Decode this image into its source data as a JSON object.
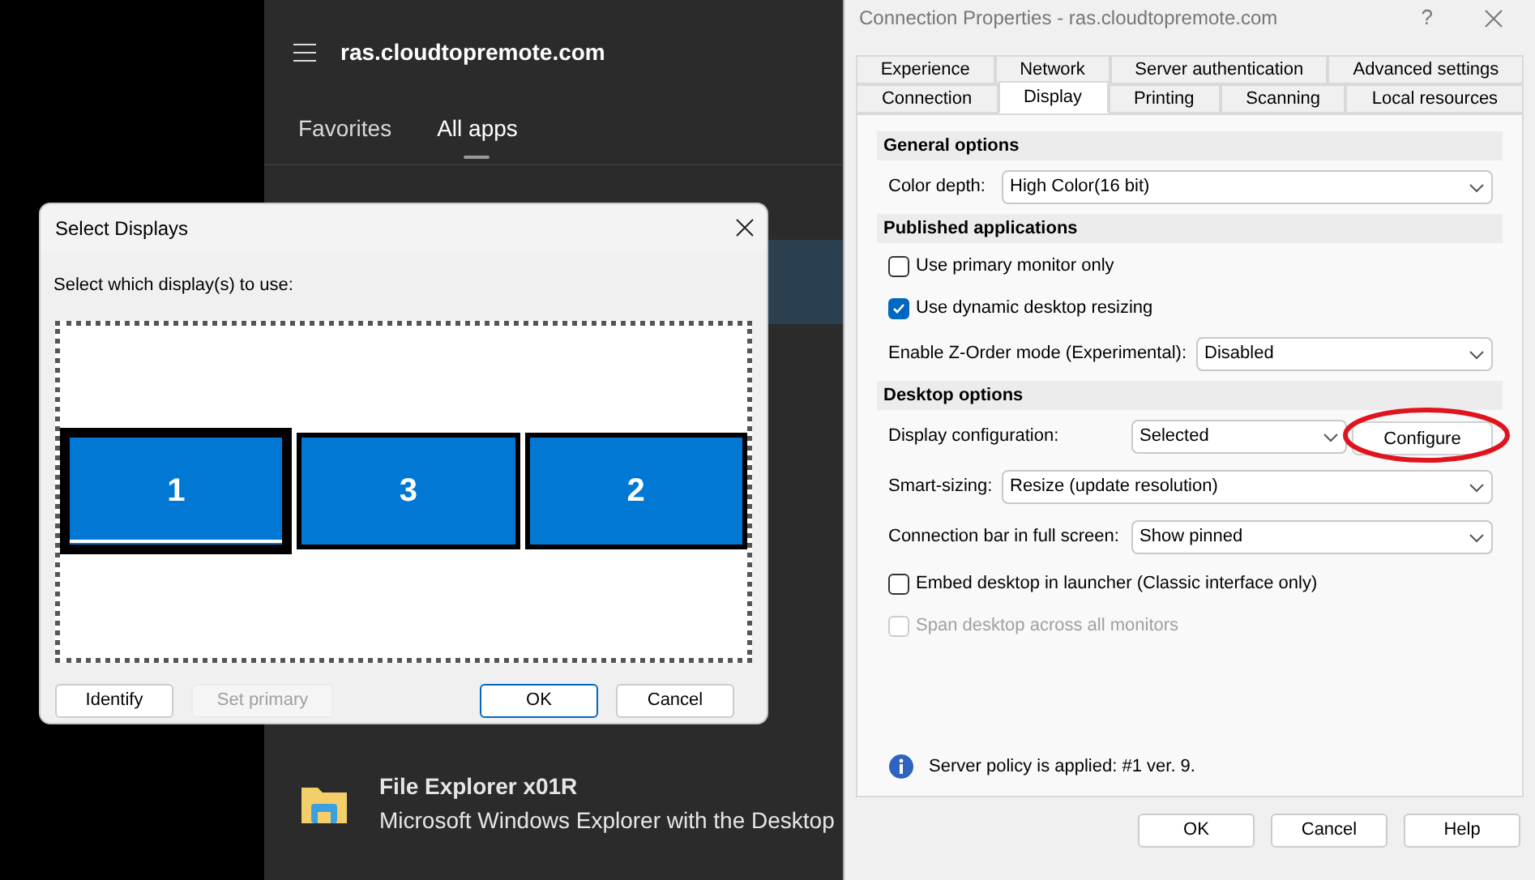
{
  "launcher": {
    "title": "ras.cloudtopremote.com",
    "tabs": [
      {
        "label": "Favorites",
        "selected": false
      },
      {
        "label": "All apps",
        "selected": true
      }
    ],
    "apps": [
      {
        "name": "File Explorer x01R",
        "description": "Microsoft Windows Explorer with the Desktop"
      }
    ]
  },
  "select_displays": {
    "title": "Select Displays",
    "prompt": "Select which display(s) to use:",
    "displays": [
      {
        "label": "1",
        "selected": true,
        "primary": true
      },
      {
        "label": "3",
        "selected": true,
        "primary": false
      },
      {
        "label": "2",
        "selected": true,
        "primary": false
      }
    ],
    "buttons": [
      {
        "label": "Identify",
        "disabled": false,
        "default": false
      },
      {
        "label": "Set primary",
        "disabled": true,
        "default": false
      },
      {
        "label": "OK",
        "disabled": false,
        "default": true
      },
      {
        "label": "Cancel",
        "disabled": false,
        "default": false
      }
    ]
  },
  "connection_properties": {
    "title": "Connection Properties - ras.cloudtopremote.com",
    "help": "?",
    "tab_rows": [
      [
        {
          "label": "Experience",
          "selected": false
        },
        {
          "label": "Network",
          "selected": false
        },
        {
          "label": "Server authentication",
          "selected": false
        },
        {
          "label": "Advanced settings",
          "selected": false
        }
      ],
      [
        {
          "label": "Connection",
          "selected": false
        },
        {
          "label": "Display",
          "selected": true
        },
        {
          "label": "Printing",
          "selected": false
        },
        {
          "label": "Scanning",
          "selected": false
        },
        {
          "label": "Local resources",
          "selected": false
        }
      ]
    ],
    "sections": [
      {
        "heading": "General options",
        "rows": [
          {
            "kind": "select",
            "label": "Color depth:",
            "value": "High Color(16 bit)"
          }
        ]
      },
      {
        "heading": "Published applications",
        "rows": [
          {
            "kind": "checkbox",
            "label": "Use primary monitor only",
            "checked": false,
            "disabled": false
          },
          {
            "kind": "checkbox",
            "label": "Use dynamic desktop resizing",
            "checked": true,
            "disabled": false
          },
          {
            "kind": "select",
            "label": "Enable Z-Order mode (Experimental):",
            "value": "Disabled"
          }
        ]
      },
      {
        "heading": "Desktop options",
        "rows": [
          {
            "kind": "select_button",
            "label": "Display configuration:",
            "value": "Selected",
            "button": "Configure",
            "highlighted": true
          },
          {
            "kind": "select",
            "label": "Smart-sizing:",
            "value": "Resize (update resolution)"
          },
          {
            "kind": "select",
            "label": "Connection bar in full screen:",
            "value": "Show pinned"
          },
          {
            "kind": "checkbox",
            "label": "Embed desktop in launcher (Classic interface only)",
            "checked": false,
            "disabled": false
          },
          {
            "kind": "checkbox",
            "label": "Span desktop across all monitors",
            "checked": false,
            "disabled": true
          }
        ]
      }
    ],
    "info": "Server policy is applied: #1 ver. 9.",
    "buttons": [
      "OK",
      "Cancel",
      "Help"
    ]
  }
}
